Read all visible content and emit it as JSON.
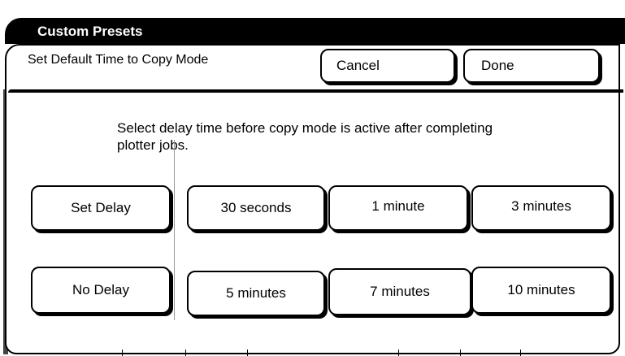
{
  "window": {
    "title": "Custom Presets"
  },
  "header": {
    "label": "Set Default Time to Copy Mode"
  },
  "actions": {
    "cancel_label": "Cancel",
    "done_label": "Done"
  },
  "instruction": "Select delay time before copy mode is active after completing plotter jobs.",
  "options": {
    "set_delay": "Set Delay",
    "no_delay": "No Delay",
    "times": [
      "30 seconds",
      "1 minute",
      "3 minutes",
      "5 minutes",
      "7 minutes",
      "10 minutes"
    ]
  }
}
